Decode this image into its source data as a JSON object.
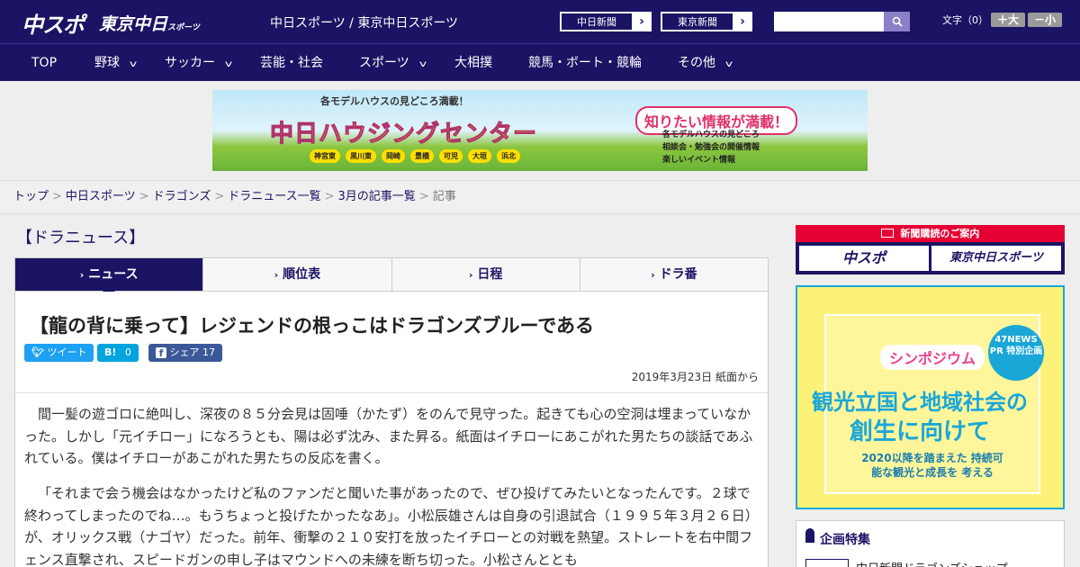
{
  "header": {
    "logo_chuspo": "中スポ",
    "logo_tokyo": "東京中日",
    "logo_tokyo_sub": "スポーツ",
    "site_name": "中日スポーツ / 東京中日スポーツ",
    "btn_chunichi": "中日新聞",
    "btn_tokyo": "東京新聞",
    "search_placeholder": "",
    "moji_label": "文字（0）",
    "size_up": "＋大",
    "size_down": "－小"
  },
  "nav": [
    {
      "label": "TOP",
      "dropdown": false
    },
    {
      "label": "野球",
      "dropdown": true
    },
    {
      "label": "サッカー",
      "dropdown": true
    },
    {
      "label": "芸能・社会",
      "dropdown": false
    },
    {
      "label": "スポーツ",
      "dropdown": true
    },
    {
      "label": "大相撲",
      "dropdown": false
    },
    {
      "label": "競馬・ボート・競輪",
      "dropdown": false
    },
    {
      "label": "その他",
      "dropdown": true
    }
  ],
  "banner": {
    "sub": "各モデルハウスの見どころ満載！",
    "main": "中日ハウジングセンター",
    "catch": "知りたい情報が満載！",
    "bullets": [
      "各モデルハウスの見どころ",
      "相談会・勉強会の開催情報",
      "楽しいイベント情報"
    ],
    "towns": [
      "神宮東",
      "黒川東",
      "岡崎",
      "豊橋",
      "可児",
      "大垣",
      "浜北"
    ]
  },
  "breadcrumb": {
    "items": [
      "トップ",
      "中日スポーツ",
      "ドラゴンズ",
      "ドラニュース一覧",
      "3月の記事一覧"
    ],
    "current": "記事",
    "sep": ">"
  },
  "section_title": "【ドラニュース】",
  "tabs": [
    {
      "label": "ニュース",
      "active": true
    },
    {
      "label": "順位表",
      "active": false
    },
    {
      "label": "日程",
      "active": false
    },
    {
      "label": "ドラ番",
      "active": false
    }
  ],
  "article": {
    "headline": "【龍の背に乗って】レジェンドの根っこはドラゴンズブルーである",
    "share": {
      "tweet": "ツイート",
      "hatena_label": "B!",
      "hatena_count": "0",
      "facebook": "シェア",
      "facebook_count": "17"
    },
    "date": "2019年3月23日 紙面から",
    "paragraphs": [
      "間一髪の遊ゴロに絶叫し、深夜の８５分会見は固唾（かたず）をのんで見守った。起きても心の空洞は埋まっていなかった。しかし「元イチロー」になろうとも、陽は必ず沈み、また昇る。紙面はイチローにあこがれた男たちの談話であふれている。僕はイチローがあこがれた男たちの反応を書く。",
      "「それまで会う機会はなかったけど私のファンだと聞いた事があったので、ぜひ投げてみたいとなったんです。２球で終わってしまったのでね…。もうちょっと投げたかったなあ」。小松辰雄さんは自身の引退試合（１９９５年３月２６日）が、オリックス戦（ナゴヤ）だった。前年、衝撃の２１０安打を放ったイチローとの対戦を熱望。ストレートを右中間フェンス直撃され、スピードガンの申し子はマウンドへの未練を断ち切った。小松さんととも"
    ]
  },
  "sidebar": {
    "subscribe_head": "新聞購読のご案内",
    "sub_logo_1": "中スポ",
    "sub_logo_2": "東京中日スポーツ",
    "ad": {
      "symposium": "シンポジウム",
      "pr_badge": "47NEWS PR 特別企画",
      "line1": "観光立国と地域社会の",
      "line2": "創生に向けて",
      "line3": "2020以降を踏まえた 持続可能な観光と成長を 考える"
    },
    "feature_title": "企画特集",
    "feature_item": "中日新聞ドラゴンズショップ"
  },
  "colors": {
    "brand_navy": "#1b1464",
    "twitter": "#1da1f2",
    "hatena": "#00a4de",
    "facebook": "#3b5998",
    "subscribe_red": "#e60033"
  }
}
